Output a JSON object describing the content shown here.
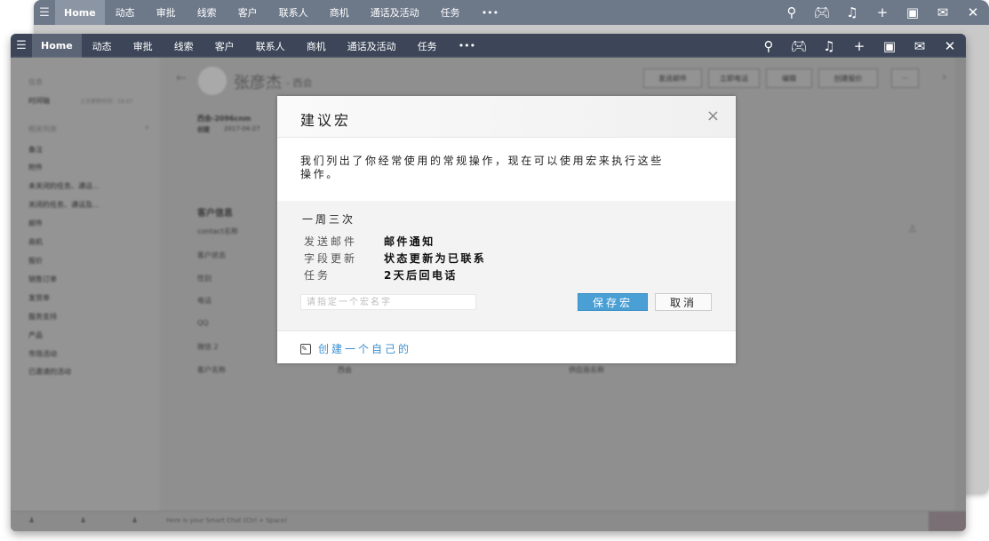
{
  "nav": {
    "home": "Home",
    "items": [
      "动态",
      "审批",
      "线索",
      "客户",
      "联系人",
      "商机",
      "通话及活动",
      "任务"
    ],
    "more": "•••",
    "icons": [
      "search-icon",
      "gamepad-icon",
      "bell-icon",
      "plus-icon",
      "calendar-icon",
      "mail-icon",
      "tools-icon"
    ]
  },
  "sidebar": {
    "info": "信息",
    "timeline": "时间轴",
    "timeline_meta": "上次更新时间：16:47",
    "related": "相关列表",
    "items": [
      "备注",
      "附件",
      "未关闭的任务、通话...",
      "关闭的任务、通话及...",
      "邮件",
      "商机",
      "报价",
      "销售订单",
      "发货单",
      "服务支持",
      "产品",
      "市场活动",
      "已邀请的活动"
    ]
  },
  "record": {
    "name": "张彦杰",
    "company": "- 西会",
    "subtitle": "西会-2096cnm",
    "date_label": "创建",
    "date": "2017-04-27",
    "buttons": [
      "发送邮件",
      "立即电话",
      "编辑",
      "创建报价",
      "···"
    ],
    "section": "客户信息",
    "fields": [
      "contact名称",
      "客户状态",
      "性别",
      "电话",
      "QQ",
      "微信 2",
      "客户名称"
    ],
    "company_value": "西会",
    "supplier_label": "供应商名称"
  },
  "bottom": {
    "chat_placeholder": "Here is your Smart Chat (Ctrl + Space)"
  },
  "modal": {
    "title": "建议宏",
    "description": "我们列出了你经常使用的常规操作，现在可以使用宏来执行这些操作。",
    "frequency": "一周三次",
    "actions": [
      {
        "label": "发送邮件",
        "value": "邮件通知"
      },
      {
        "label": "字段更新",
        "value": "状态更新为已联系"
      },
      {
        "label": "任务",
        "value": "2天后回电话"
      }
    ],
    "input_placeholder": "请指定一个宏名字",
    "save": "保存宏",
    "cancel": "取消",
    "create_own": "创建一个自己的",
    "accent": "#4a9fd5"
  }
}
